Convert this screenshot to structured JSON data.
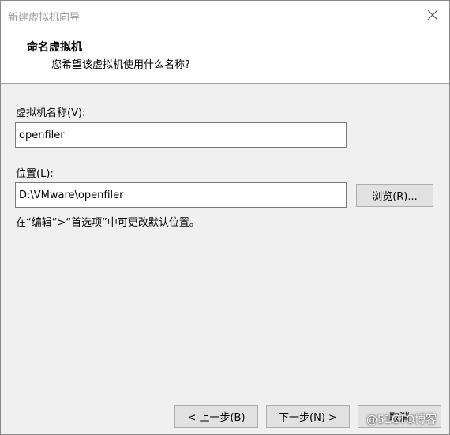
{
  "window": {
    "title": "新建虚拟机向导"
  },
  "header": {
    "title": "命名虚拟机",
    "subtitle": "您希望该虚拟机使用什么名称?"
  },
  "form": {
    "name_label": "虚拟机名称(V):",
    "name_value": "openfiler",
    "location_label": "位置(L):",
    "location_value": "D:\\VMware\\openfiler",
    "browse_label": "浏览(R)...",
    "hint": "在“编辑”>“首选项”中可更改默认位置。"
  },
  "footer": {
    "back_label": "< 上一步(B)",
    "next_label": "下一步(N) >",
    "cancel_label": "取消"
  },
  "watermark": "@51CTO博客",
  "icons": {
    "close": "close-icon"
  }
}
